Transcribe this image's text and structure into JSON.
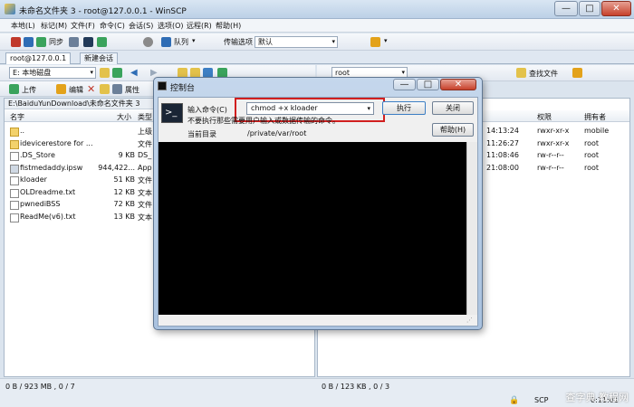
{
  "window": {
    "title": "未命名文件夹 3 - root@127.0.0.1 - WinSCP"
  },
  "menu": [
    "本地(L)",
    "标记(M)",
    "文件(F)",
    "命令(C)",
    "会话(S)",
    "选项(O)",
    "远程(R)",
    "帮助(H)"
  ],
  "toolbar1": {
    "sync_label": "同步",
    "queue_label": "队列",
    "transfer_label": "传输选项",
    "transfer_value": "默认"
  },
  "tabs": {
    "session": "root@127.0.0.1",
    "new_session": "新建会话"
  },
  "left_panel": {
    "drive": "E: 本地磁盘",
    "actions": {
      "upload": "上传",
      "edit": "编辑",
      "properties": "属性"
    },
    "path": "E:\\BaiduYunDownload\\未命名文件夹 3",
    "columns": {
      "name": "名字",
      "size": "大小",
      "type": "类型"
    },
    "rows": [
      {
        "name": "..",
        "size": "",
        "type": "上级"
      },
      {
        "name": "idevicerestore for ...",
        "size": "",
        "type": "文件"
      },
      {
        "name": ".DS_Store",
        "size": "9 KB",
        "type": "DS_"
      },
      {
        "name": "fistmedaddy.ipsw",
        "size": "944,422...",
        "type": "App"
      },
      {
        "name": "kloader",
        "size": "51 KB",
        "type": "文件"
      },
      {
        "name": "OLDreadme.txt",
        "size": "12 KB",
        "type": "文本"
      },
      {
        "name": "pwnediBSS",
        "size": "72 KB",
        "type": "文件"
      },
      {
        "name": "ReadMe(v6).txt",
        "size": "13 KB",
        "type": "文本"
      }
    ],
    "status": "0 B / 923 MB , 0 / 7"
  },
  "right_panel": {
    "dir": "root",
    "find_label": "查找文件",
    "columns": {
      "rights": "权限",
      "owner": "拥有者"
    },
    "rows": [
      {
        "time": "14:13:24",
        "rights": "rwxr-xr-x",
        "owner": "mobile"
      },
      {
        "time": "11:26:27",
        "rights": "rwxr-xr-x",
        "owner": "root"
      },
      {
        "time": "11:08:46",
        "rights": "rw-r--r--",
        "owner": "root"
      },
      {
        "time": "21:08:00",
        "rights": "rw-r--r--",
        "owner": "root"
      }
    ],
    "status": "0 B / 123 KB , 0 / 3"
  },
  "statusbar": {
    "protocol": "SCP",
    "time": "0:11:01"
  },
  "dialog": {
    "title": "控制台",
    "input_label": "输入命令(C)",
    "command": "chmod +x kloader",
    "warning": "不要执行那些需要用户输入或数据传输的命令。",
    "dir_label": "当前目录",
    "dir_value": "/private/var/root",
    "execute_label": "执行",
    "close_label": "关闭",
    "help_label": "帮助(H)"
  },
  "watermark": "查字典 教程网"
}
